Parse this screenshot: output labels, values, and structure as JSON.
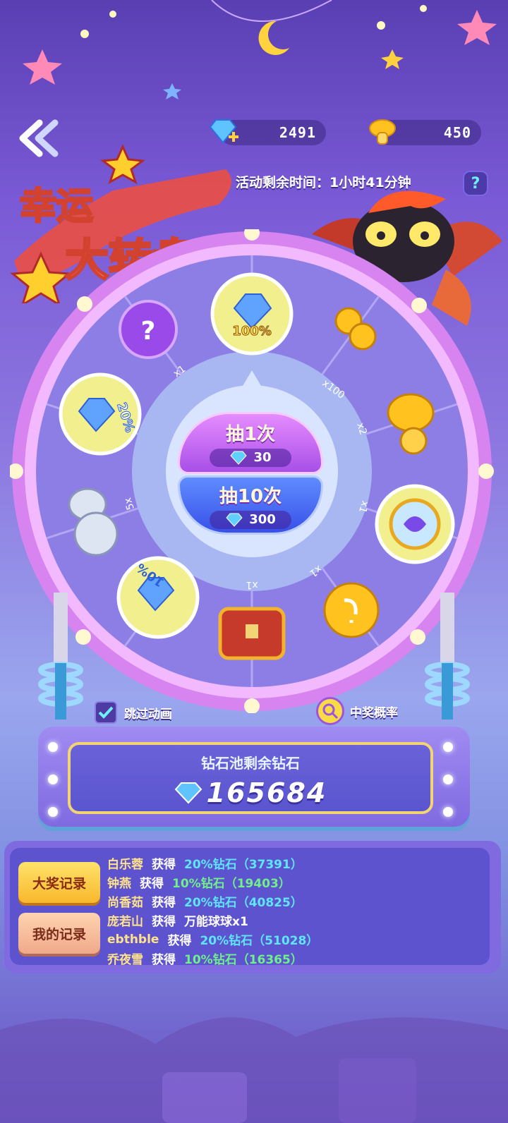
{
  "header": {
    "back_icon": "double-chevron-left-icon",
    "diamond_count": "2491",
    "mushroom_count": "450",
    "timer_text": "活动剩余时间：1小时41分钟",
    "help_label": "?"
  },
  "logo": {
    "line1": "幸运",
    "line2": "大转盘"
  },
  "wheel": {
    "segments": [
      {
        "label": "100%",
        "icon": "diamond-pile-icon"
      },
      {
        "label": "x100",
        "icon": "gold-coins-icon"
      },
      {
        "label": "x2",
        "icon": "gold-mushroom-icon"
      },
      {
        "label": "x1",
        "icon": "rainbow-orb-icon"
      },
      {
        "label": "x1",
        "icon": "gold-egg-icon"
      },
      {
        "label": "x1",
        "icon": "treasure-chest-icon"
      },
      {
        "label": "10%",
        "icon": "diamond-pile-icon"
      },
      {
        "label": "5x",
        "icon": "silver-mushroom-icon"
      },
      {
        "label": "20%",
        "icon": "diamond-pile-icon"
      },
      {
        "label": "x1",
        "icon": "mystery-ball-icon"
      }
    ]
  },
  "draw": {
    "single_title": "抽1次",
    "single_cost": "30",
    "ten_title": "抽10次",
    "ten_cost": "300"
  },
  "options": {
    "skip_label": "跳过动画",
    "skip_checked": true,
    "odds_label": "中奖概率"
  },
  "pool": {
    "title": "钻石池剩余钻石",
    "value": "165684"
  },
  "records": {
    "tab_jackpot": "大奖记录",
    "tab_mine": "我的记录",
    "rows": [
      {
        "name": "白乐蓉",
        "verb": "获得",
        "prize": "20%钻石（37391）",
        "tone": "cyan"
      },
      {
        "name": "钟燕",
        "verb": "获得",
        "prize": "10%钻石（19403）",
        "tone": "green"
      },
      {
        "name": "尚香茹",
        "verb": "获得",
        "prize": "20%钻石（40825）",
        "tone": "cyan"
      },
      {
        "name": "庞若山",
        "verb": "获得",
        "prize": "万能球球x1",
        "tone": "plain"
      },
      {
        "name": "ebthble",
        "verb": "获得",
        "prize": "20%钻石（51028）",
        "tone": "cyan"
      },
      {
        "name": "乔夜雪",
        "verb": "获得",
        "prize": "10%钻石（16365）",
        "tone": "green"
      }
    ]
  },
  "colors": {
    "accent_yellow": "#f8b82c",
    "pool_border": "#f3d474",
    "wheel_rim": "#e58ff0",
    "wheel_inner": "#8d7ee6"
  }
}
